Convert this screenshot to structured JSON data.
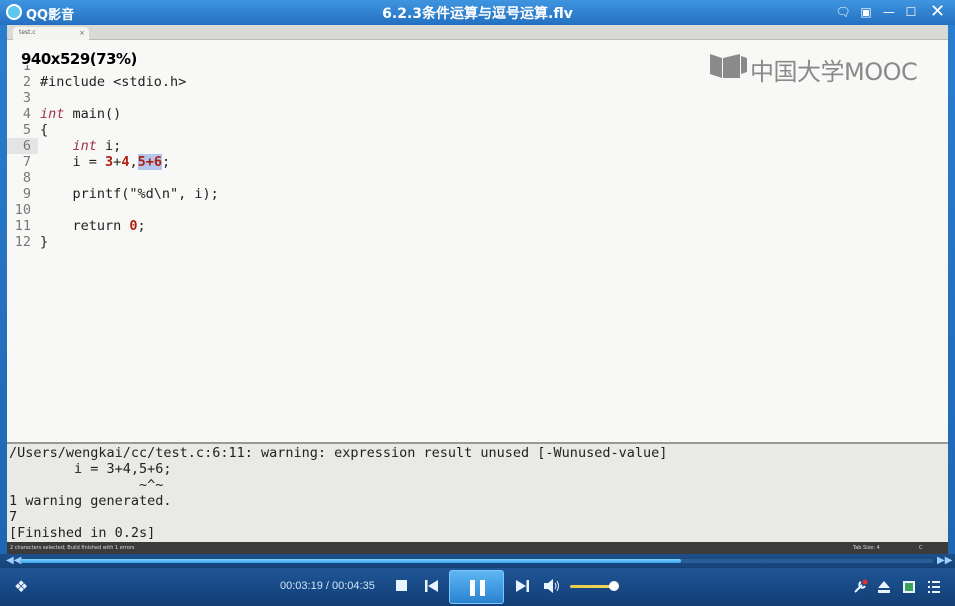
{
  "window": {
    "app_name": "QQ影音",
    "file_title": "6.2.3条件运算与逗号运算.flv"
  },
  "editor": {
    "tab_label": "test.c",
    "tab_close": "×",
    "overlay_resolution": "940x529(73%)",
    "mooc_brand": "中国大学MOOC",
    "lines": [
      {
        "n": "1",
        "text": "#include <stdio.h>"
      },
      {
        "n": "2",
        "text": ""
      },
      {
        "n": "3",
        "kw": "int",
        "rest": " main()"
      },
      {
        "n": "4",
        "text": "{"
      },
      {
        "n": "5",
        "indent": "    ",
        "kw": "int",
        "rest": " i;"
      },
      {
        "n": "6",
        "pre": "    i = ",
        "n1": "3",
        "mid": "+",
        "n2": "4",
        "comma": ",",
        "sel": "5+6",
        "post": ";"
      },
      {
        "n": "7",
        "text": ""
      },
      {
        "n": "8",
        "text": "    printf(\"%d\\n\", i);"
      },
      {
        "n": "9",
        "text": ""
      },
      {
        "n": "10",
        "pre": "    return ",
        "num": "0",
        "post": ";"
      },
      {
        "n": "11",
        "text": "}"
      },
      {
        "n": "12",
        "text": ""
      }
    ]
  },
  "console": {
    "lines": [
      "/Users/wengkai/cc/test.c:6:11: warning: expression result unused [-Wunused-value]",
      "        i = 3+4,5+6;",
      "                ~^~",
      "1 warning generated.",
      "7",
      "[Finished in 0.2s]"
    ]
  },
  "statusbar": {
    "left": "2 characters selected; Build finished with 1 errors",
    "tab_size": "Tab Size: 4",
    "syntax": "C"
  },
  "player": {
    "time": "00:03:19 / 00:04:35",
    "progress": 0.7236,
    "volume": 0.86,
    "colors": {
      "accent": "#3aa6ee",
      "volume": "#e8c84a"
    }
  }
}
